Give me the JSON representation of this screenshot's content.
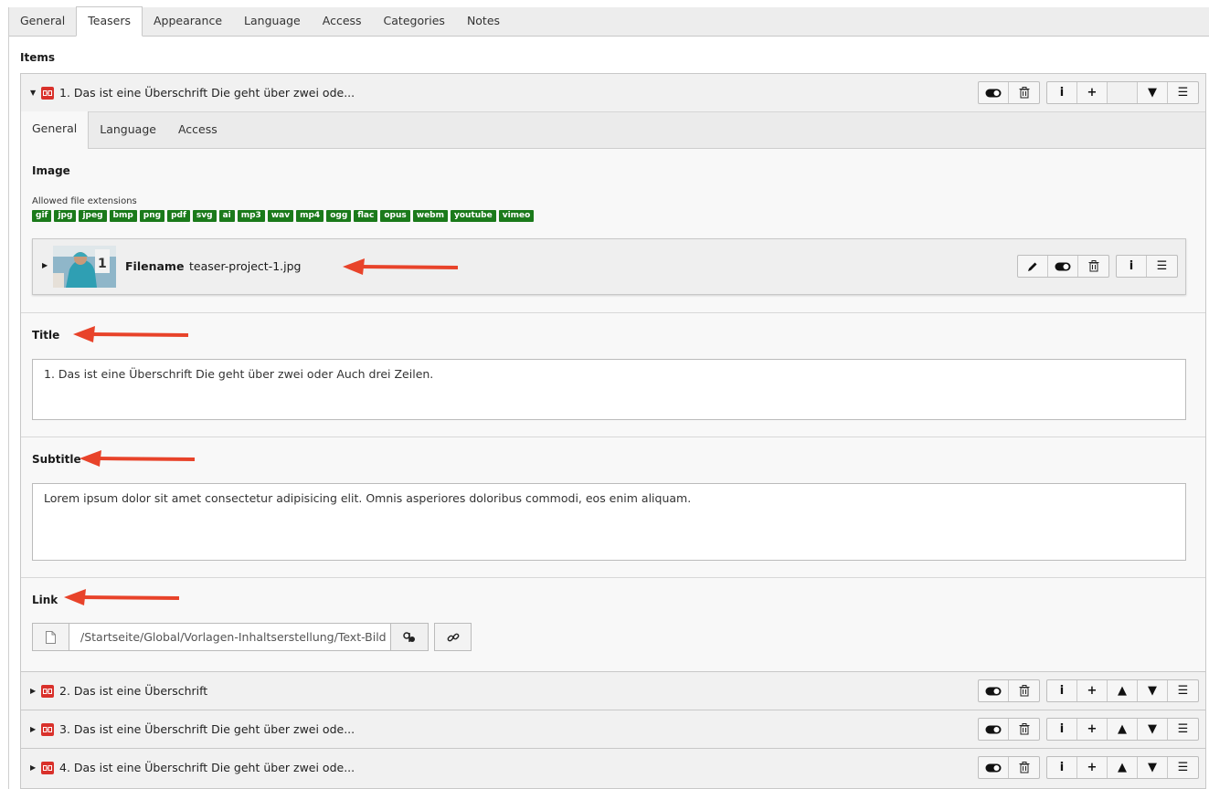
{
  "tabs": [
    "General",
    "Teasers",
    "Appearance",
    "Language",
    "Access",
    "Categories",
    "Notes"
  ],
  "items_label": "Items",
  "expanded_item": {
    "title": "1. Das ist eine Überschrift Die geht über zwei ode...",
    "subtabs": [
      "General",
      "Language",
      "Access"
    ],
    "image_label": "Image",
    "allowed_ext_label": "Allowed file extensions",
    "extensions": [
      "gif",
      "jpg",
      "jpeg",
      "bmp",
      "png",
      "pdf",
      "svg",
      "ai",
      "mp3",
      "wav",
      "mp4",
      "ogg",
      "flac",
      "opus",
      "webm",
      "youtube",
      "vimeo"
    ],
    "file": {
      "label": "Filename",
      "value": "teaser-project-1.jpg"
    },
    "title_label": "Title",
    "title_value": "1. Das ist eine Überschrift Die geht über zwei oder Auch drei Zeilen.",
    "subtitle_label": "Subtitle",
    "subtitle_value": "Lorem ipsum dolor sit amet consectetur adipisicing elit. Omnis asperiores doloribus commodi, eos enim aliquam.",
    "link_label": "Link",
    "link_value": "/Startseite/Global/Vorlagen-Inhaltserstellung/Text-Bild"
  },
  "collapsed_items": [
    "2. Das ist eine Überschrift",
    "3. Das ist eine Überschrift Die geht über zwei ode...",
    "4. Das ist eine Überschrift Die geht über zwei ode..."
  ],
  "colors": {
    "ext_badge": "#1b7a1b",
    "ce_icon": "#d9312b",
    "arrow": "#e8432a"
  },
  "icons": [
    "toggle-icon",
    "trash-icon",
    "info-icon",
    "plus-icon",
    "up-icon",
    "down-icon",
    "drag-menu-icon",
    "pencil-icon",
    "page-icon",
    "link-browser-icon",
    "chain-link-icon"
  ]
}
